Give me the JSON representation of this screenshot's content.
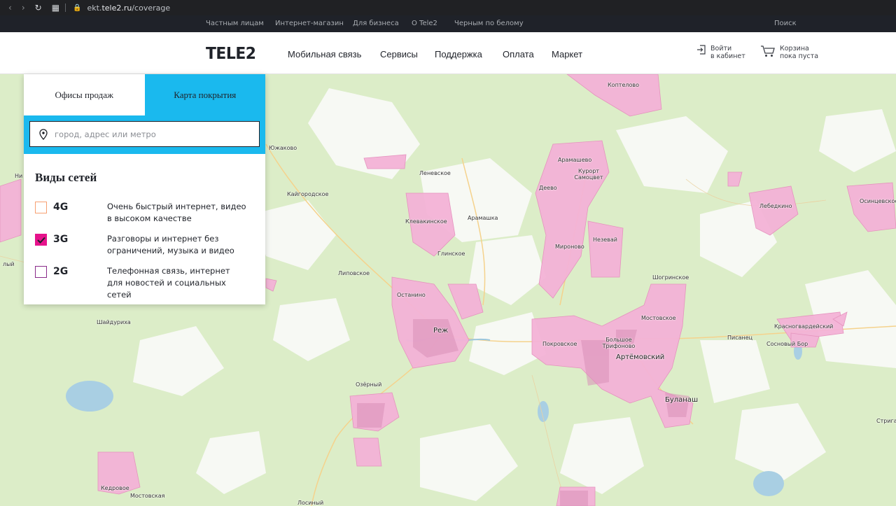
{
  "browser": {
    "url_prefix": "ekt.",
    "url_domain": "tele2.ru",
    "url_path": "/coverage"
  },
  "topnav": {
    "items": [
      "Частным лицам",
      "Интернет-магазин",
      "Для бизнеса",
      "О Tele2",
      "Черным по белому"
    ],
    "search": "Поиск"
  },
  "header": {
    "logo": "TELE2",
    "nav": [
      "Мобильная связь",
      "Сервисы",
      "Поддержка",
      "Оплата",
      "Маркет"
    ],
    "login": [
      "Войти",
      "в кабинет"
    ],
    "cart": [
      "Корзина",
      "пока пуста"
    ]
  },
  "panel": {
    "tabs": [
      "Офисы продаж",
      "Карта покрытия"
    ],
    "active_tab": 1,
    "search_placeholder": "город, адрес или метро",
    "heading": "Виды сетей",
    "networks": [
      {
        "name": "4G",
        "desc": "Очень быстрый интернет, видео в высоком качестве",
        "checked": false,
        "color": "#f7a072"
      },
      {
        "name": "3G",
        "desc": "Разговоры и интернет без ограничений, музыка и видео",
        "checked": true,
        "color": "#e6138c"
      },
      {
        "name": "2G",
        "desc": "Телефонная связь, интернет для новостей и социальных сетей",
        "checked": false,
        "color": "#8a2b8a"
      }
    ]
  },
  "map": {
    "places": [
      "Коптелово",
      "Южаково",
      "Леневское",
      "Арамашево",
      "Курорт Самоцвет",
      "Деево",
      "Кайгородское",
      "Клевакинское",
      "Арамашка",
      "Лебедкино",
      "Осинцевское",
      "Мироново",
      "Незевай",
      "Глинское",
      "Липовское",
      "Шогринское",
      "Останино",
      "Мостовское",
      "Шайдуриха",
      "Реж",
      "Покровское",
      "Большое Трифоново",
      "Артёмовский",
      "Красногвардейский",
      "Писанец",
      "Сосновый Бор",
      "Озёрный",
      "Буланаш",
      "Стрига",
      "Кедровое",
      "Мостовская",
      "Лосиный",
      "Ни",
      "лый"
    ]
  }
}
